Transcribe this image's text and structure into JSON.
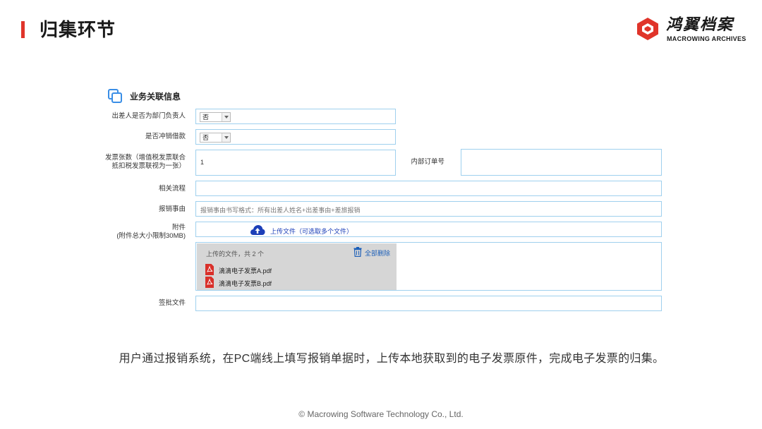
{
  "header": {
    "title": "归集环节",
    "accent_color": "#e0342a"
  },
  "logo": {
    "name_cn": "鸿翼档案",
    "name_en": "MACROWING ARCHIVES",
    "mark_color": "#e0342a"
  },
  "form": {
    "section_title": "业务关联信息",
    "section_icon": "copy-icon",
    "fields": {
      "dept_head": {
        "label": "出差人是否为部门负责人",
        "value": "否"
      },
      "loan_offset": {
        "label": "是否冲销借款",
        "value": "否"
      },
      "invoice_count": {
        "label_line1": "发票张数（增值税发票联合",
        "label_line2": "抵扣税发票联视为一张）",
        "value": "1"
      },
      "internal_order": {
        "label": "内部订单号",
        "value": ""
      },
      "related_process": {
        "label": "相关流程",
        "value": ""
      },
      "reimburse_reason": {
        "label": "报销事由",
        "placeholder": "报销事由书写格式：所有出差人姓名+出差事由+差旅报销"
      },
      "attachment": {
        "label_line1": "附件",
        "label_line2": "(附件总大小限制30MB)",
        "upload_label": "上传文件（可选取多个文件）"
      },
      "uploaded": {
        "count_text": "上传的文件，共 2 个",
        "delete_all_label": "全部删除",
        "files": [
          "滴滴电子发票A.pdf",
          "滴滴电子发票B.pdf"
        ]
      },
      "approval_file": {
        "label": "签批文件",
        "value": ""
      }
    },
    "border_color": "#9fd0ee"
  },
  "caption": "用户通过报销系统，在PC端线上填写报销单据时，上传本地获取到的电子发票原件，完成电子发票的归集。",
  "footer": "© Macrowing Software Technology Co., Ltd."
}
